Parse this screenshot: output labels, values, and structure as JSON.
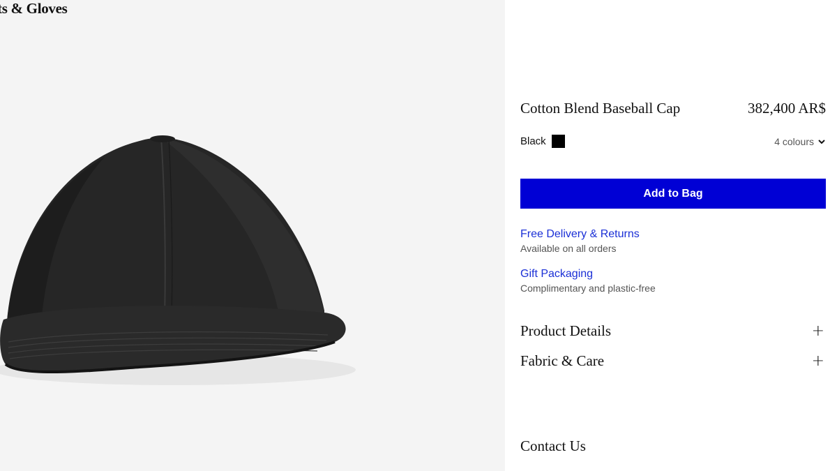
{
  "breadcrumb": {
    "label": "ts & Gloves"
  },
  "product": {
    "name": "Cotton Blend Baseball Cap",
    "price": "382,400 AR$",
    "image_icon": "baseball-cap-image"
  },
  "colour": {
    "selected": "Black",
    "swatch_color": "#000000",
    "options_label": "4 colours"
  },
  "actions": {
    "add_to_bag": "Add to Bag",
    "button_color": "#0000d5"
  },
  "services": [
    {
      "title": "Free Delivery & Returns",
      "subtitle": "Available on all orders"
    },
    {
      "title": "Gift Packaging",
      "subtitle": "Complimentary and plastic-free"
    }
  ],
  "accordions": [
    {
      "label": "Product Details",
      "icon": "plus-icon",
      "symbol": "+"
    },
    {
      "label": "Fabric & Care",
      "icon": "plus-icon",
      "symbol": "+"
    }
  ],
  "contact": {
    "label": "Contact Us"
  }
}
